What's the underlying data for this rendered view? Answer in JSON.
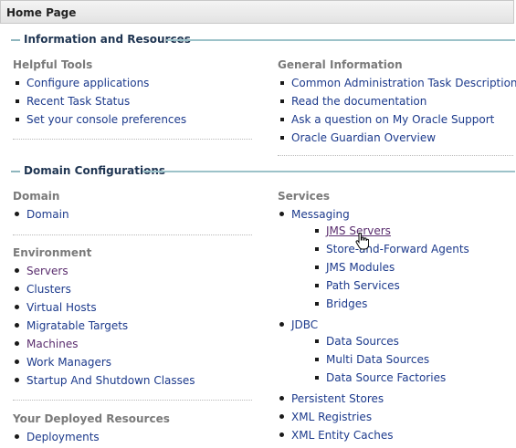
{
  "page_title": "Home Page",
  "sections": {
    "info": "Information and Resources",
    "domain_config": "Domain Configurations"
  },
  "helpful_tools": {
    "title": "Helpful Tools",
    "items": [
      "Configure applications",
      "Recent Task Status",
      "Set your console preferences"
    ]
  },
  "general_info": {
    "title": "General Information",
    "items": [
      "Common Administration Task Descriptions",
      "Read the documentation",
      "Ask a question on My Oracle Support",
      "Oracle Guardian Overview"
    ]
  },
  "domain": {
    "title": "Domain",
    "items": [
      "Domain"
    ]
  },
  "environment": {
    "title": "Environment",
    "items": [
      "Servers",
      "Clusters",
      "Virtual Hosts",
      "Migratable Targets",
      "Machines",
      "Work Managers",
      "Startup And Shutdown Classes"
    ]
  },
  "deployed": {
    "title": "Your Deployed Resources",
    "items": [
      "Deployments"
    ]
  },
  "services": {
    "title": "Services",
    "messaging": {
      "label": "Messaging",
      "items": [
        "JMS Servers",
        "Store-and-Forward Agents",
        "JMS Modules",
        "Path Services",
        "Bridges"
      ]
    },
    "jdbc": {
      "label": "JDBC",
      "items": [
        "Data Sources",
        "Multi Data Sources",
        "Data Source Factories"
      ]
    },
    "others": [
      "Persistent Stores",
      "XML Registries",
      "XML Entity Caches"
    ]
  }
}
